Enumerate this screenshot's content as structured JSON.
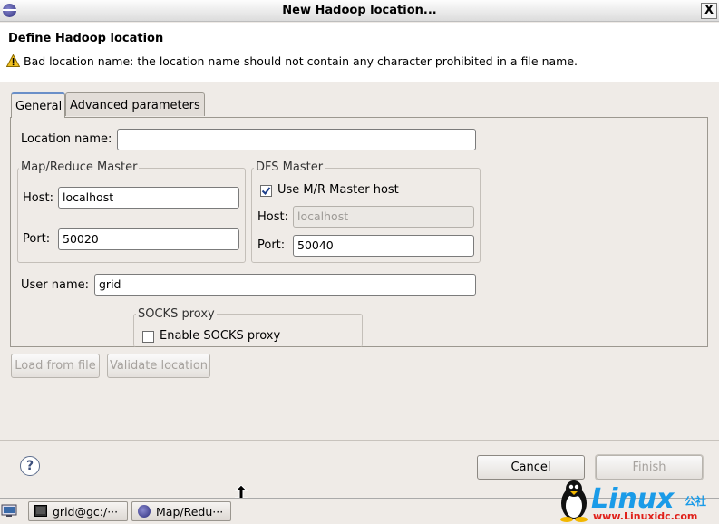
{
  "window": {
    "title": "New Hadoop location...",
    "close_glyph": "X"
  },
  "header": {
    "title": "Define Hadoop location",
    "message": "Bad location name: the location name should not contain any character prohibited in a file name."
  },
  "tabs": [
    {
      "label": "General"
    },
    {
      "label": "Advanced parameters"
    }
  ],
  "general": {
    "location_name_label": "Location name:",
    "location_name_value": "",
    "mr_master": {
      "title": "Map/Reduce Master",
      "host_label": "Host:",
      "host_value": "localhost",
      "port_label": "Port:",
      "port_value": "50020"
    },
    "dfs_master": {
      "title": "DFS Master",
      "use_mr_label": "Use M/R Master host",
      "use_mr_checked": true,
      "host_label": "Host:",
      "host_value": "localhost",
      "port_label": "Port:",
      "port_value": "50040"
    },
    "user_name_label": "User name:",
    "user_name_value": "grid",
    "socks": {
      "title": "SOCKS proxy",
      "enable_label": "Enable SOCKS proxy",
      "enable_checked": false
    }
  },
  "actions": {
    "load_from_file": "Load from file",
    "validate_location": "Validate location",
    "cancel": "Cancel",
    "finish": "Finish",
    "help_glyph": "?"
  },
  "taskbar": {
    "items": [
      {
        "label": "grid@gc:/···",
        "icon": "terminal-icon"
      },
      {
        "label": "Map/Redu···",
        "icon": "eclipse-icon"
      }
    ]
  },
  "watermark": {
    "brand": "Linux",
    "suffix": "公社",
    "url": "www.Linuxidc.com"
  },
  "colors": {
    "accent": "#1a9be8",
    "warning": "#f0c020",
    "tab_highlight": "#6a8fc8"
  }
}
